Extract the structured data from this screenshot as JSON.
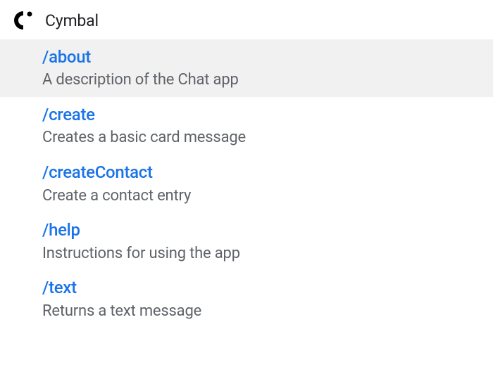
{
  "header": {
    "app_name": "Cymbal"
  },
  "commands": [
    {
      "name": "/about",
      "description": "A description of the Chat app",
      "selected": true
    },
    {
      "name": "/create",
      "description": "Creates a basic card message",
      "selected": false
    },
    {
      "name": "/createContact",
      "description": "Create a contact entry",
      "selected": false
    },
    {
      "name": "/help",
      "description": "Instructions for using the app",
      "selected": false
    },
    {
      "name": "/text",
      "description": "Returns a text message",
      "selected": false
    }
  ]
}
